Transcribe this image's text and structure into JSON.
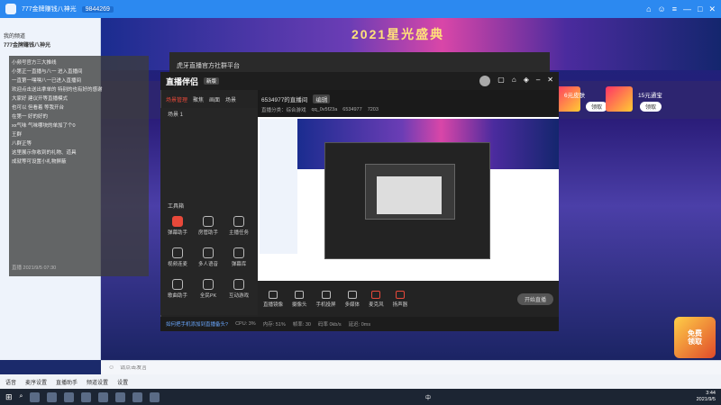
{
  "window": {
    "title": "777金牌赚钱八神光",
    "id_text": "9844269",
    "controls": [
      "—",
      "□",
      "✕"
    ]
  },
  "left_panel": {
    "header": "我的频道",
    "channel": "777金牌赚钱八神光",
    "lines": [
      "小频号官方三大推线",
      "小第正一直播与八一 进入直播间",
      "一直第一嘿嘿八一已进入直播间"
    ]
  },
  "chat_overlay": {
    "lines": [
      "小频号官方三大推线",
      "小第正一直播与八一 进入直播间",
      "一直第一嘿嘿八一已进入直播间",
      "欢迎点击送出拿单的 特别的也有好的感谢",
      "大家好 建议开等直播模式",
      "也可以 但看着 等我开台",
      "在第一 好的好的",
      "xx气味 气味哪块的单加了个0",
      "王群",
      "八群正等",
      "这里展示你收到的礼物、道具",
      "成就等可设置小礼物屏蔽"
    ],
    "footer": "直播 2021/9/5 07:30"
  },
  "banner": {
    "title": "2021星光盛典"
  },
  "gifts": {
    "item1": "6元皮肤",
    "item2": "15元通宝",
    "btn": "领取"
  },
  "bg_window": {
    "title": "虎牙直播官方社群平台"
  },
  "anchor_window": {
    "logo": "直播伴侣",
    "badge": "新版",
    "tabs": [
      "场景管理",
      "聚焦",
      "画面",
      "场景"
    ],
    "scene": "场景 1",
    "room_title": "6534977的直播间",
    "room_tag": "编辑",
    "info": [
      "直播分类：综合游戏",
      "qq_0v5f23a",
      "6534977",
      "7203"
    ],
    "tools_label": "工具箱",
    "tools": [
      {
        "label": "弹幕助手",
        "on": true
      },
      {
        "label": "房管助手",
        "on": false
      },
      {
        "label": "主播任务",
        "on": false
      },
      {
        "label": "视频连麦",
        "on": false
      },
      {
        "label": "多人语音",
        "on": false
      },
      {
        "label": "弹幕库",
        "on": false
      },
      {
        "label": "歌曲助手",
        "on": false
      },
      {
        "label": "全民PK",
        "on": false
      },
      {
        "label": "互动游戏",
        "on": false
      }
    ],
    "bottom": [
      "直播镜像",
      "摄像头",
      "手机投屏",
      "多媒体",
      "麦克风",
      "扬声器"
    ],
    "golive": "开始直播",
    "status": [
      "如何把手机添加到直播备头?",
      "CPU: 3%",
      "内存: 51%",
      "帧率: 30",
      "码率 0kb/s",
      "延迟: 0ms"
    ]
  },
  "chat_input": {
    "placeholder": "请点击发言"
  },
  "msg_bar": {
    "items": [
      "语音",
      "麦序设置",
      "直播助手",
      "频道设置",
      "设置"
    ]
  },
  "promo": {
    "line1": "免费",
    "line2": "领取"
  },
  "taskbar": {
    "time": "3:44",
    "date": "2021/9/5",
    "tray": "中"
  }
}
